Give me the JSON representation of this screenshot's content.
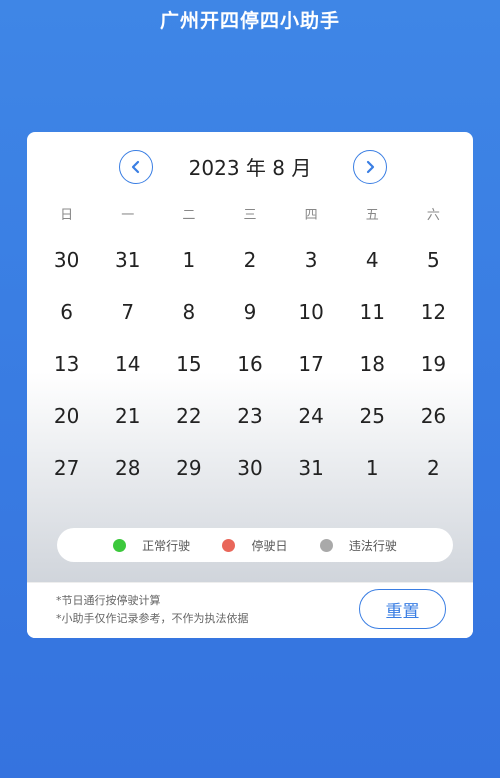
{
  "header": {
    "title": "广州开四停四小助手"
  },
  "calendar": {
    "month_label": "2023 年 8 月",
    "weekdays": [
      "日",
      "一",
      "二",
      "三",
      "四",
      "五",
      "六"
    ],
    "days": [
      "30",
      "31",
      "1",
      "2",
      "3",
      "4",
      "5",
      "6",
      "7",
      "8",
      "9",
      "10",
      "11",
      "12",
      "13",
      "14",
      "15",
      "16",
      "17",
      "18",
      "19",
      "20",
      "21",
      "22",
      "23",
      "24",
      "25",
      "26",
      "27",
      "28",
      "29",
      "30",
      "31",
      "1",
      "2"
    ]
  },
  "legend": {
    "items": [
      {
        "label": "正常行驶",
        "color": "#3cc83c"
      },
      {
        "label": "停驶日",
        "color": "#e9675a"
      },
      {
        "label": "违法行驶",
        "color": "#a9a9a9"
      }
    ]
  },
  "footer": {
    "note1": "*节日通行按停驶计算",
    "note2": "*小助手仅作记录参考，不作为执法依据",
    "reset_label": "重置"
  },
  "colors": {
    "accent": "#3a7ee3",
    "background": "#3f86e6"
  }
}
